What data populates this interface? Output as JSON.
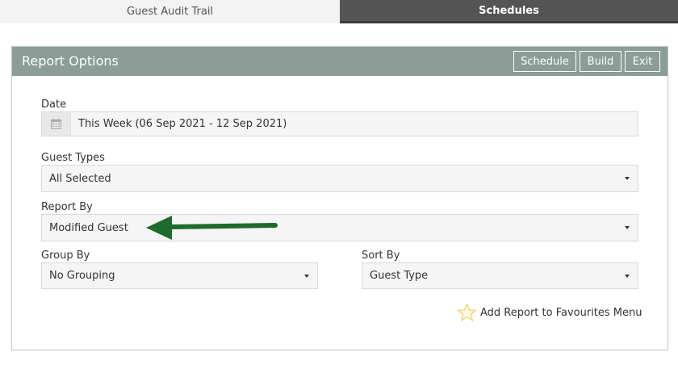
{
  "tabs": [
    {
      "label": "Guest Audit Trail",
      "active": false
    },
    {
      "label": "Schedules",
      "active": true
    }
  ],
  "panel": {
    "title": "Report Options",
    "buttons": {
      "schedule": "Schedule",
      "build": "Build",
      "exit": "Exit"
    }
  },
  "form": {
    "date": {
      "label": "Date",
      "value": "This Week (06 Sep 2021 - 12 Sep 2021)",
      "icon": "calendar-icon"
    },
    "guest_types": {
      "label": "Guest Types",
      "value": "All Selected"
    },
    "report_by": {
      "label": "Report By",
      "value": "Modified Guest"
    },
    "group_by": {
      "label": "Group By",
      "value": "No Grouping"
    },
    "sort_by": {
      "label": "Sort By",
      "value": "Guest Type"
    }
  },
  "favourites": {
    "label": "Add Report to Favourites Menu",
    "icon": "star-icon"
  },
  "colors": {
    "header": "#8b9d96",
    "active_tab": "#555555",
    "arrow": "#1e6b2c",
    "star": "#f0d060"
  }
}
